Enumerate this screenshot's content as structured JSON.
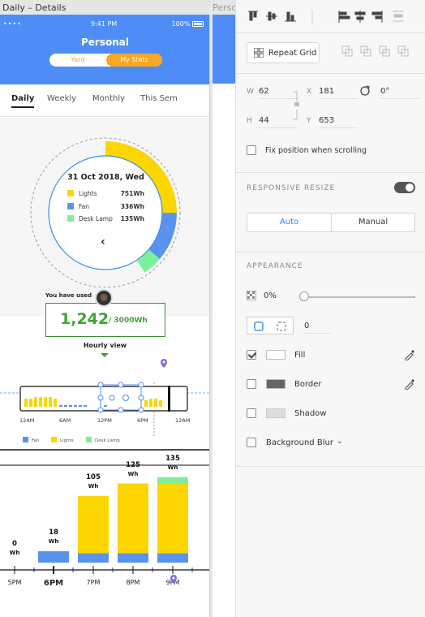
{
  "canvas": {
    "artboard_title": "Daily – Details",
    "artboard2_title": "Perso"
  },
  "phone": {
    "status": {
      "signal": "••••",
      "time": "9:41 PM",
      "battery": "100%"
    },
    "title": "Personal",
    "segment": {
      "left": "Yard",
      "right": "My Stats",
      "selected": "My Stats"
    },
    "tabs": [
      {
        "label": "Daily",
        "active": true
      },
      {
        "label": "Weekly",
        "active": false
      },
      {
        "label": "Monthly",
        "active": false
      },
      {
        "label": "This Sem",
        "active": false
      }
    ],
    "donut": {
      "date": "31 Oct 2018, Wed",
      "legend": [
        {
          "name": "Lights",
          "value": "751Wh",
          "color": "#fdd600"
        },
        {
          "name": "Fan",
          "value": "336Wh",
          "color": "#5a93ee"
        },
        {
          "name": "Desk Lamp",
          "value": "135Wh",
          "color": "#7cf09a"
        }
      ],
      "segments": [
        {
          "name": "Lights",
          "value": 751
        },
        {
          "name": "Fan",
          "value": 336
        },
        {
          "name": "Desk Lamp",
          "value": 135
        }
      ],
      "total": 3000,
      "prev_icon": "‹"
    },
    "usage": {
      "caption": "You have used",
      "value": "1,242",
      "total": "/ 3000Wh"
    },
    "hourly": {
      "label": "Hourly view",
      "ticks": [
        "12AM",
        "6AM",
        "12PM",
        "6PM",
        "12AM"
      ],
      "legend": [
        {
          "name": "Fan",
          "color": "#5a93ee"
        },
        {
          "name": "Lights",
          "color": "#fdd600"
        },
        {
          "name": "Desk Lamp",
          "color": "#7cf09a"
        }
      ]
    }
  },
  "chart_data": {
    "type": "bar",
    "categories": [
      "5PM",
      "6PM",
      "7PM",
      "8PM",
      "9PM"
    ],
    "series": [
      {
        "name": "Fan",
        "values": [
          0,
          18,
          15,
          15,
          15
        ]
      },
      {
        "name": "Lights",
        "values": [
          0,
          0,
          90,
          110,
          110
        ]
      },
      {
        "name": "Desk Lamp",
        "values": [
          0,
          0,
          0,
          0,
          10
        ]
      }
    ],
    "totals": [
      "0",
      "18",
      "105",
      "125",
      "135"
    ],
    "unit": "Wh",
    "selected": "6PM",
    "ylim": [
      0,
      140
    ]
  },
  "inspector": {
    "repeat_grid": "Repeat Grid",
    "w_label": "W",
    "w_value": "62",
    "h_label": "H",
    "h_value": "44",
    "x_label": "X",
    "x_value": "181",
    "y_label": "Y",
    "y_value": "653",
    "rotation": "0°",
    "fix_position": "Fix position when scrolling",
    "responsive_title": "RESPONSIVE RESIZE",
    "auto": "Auto",
    "manual": "Manual",
    "appearance_title": "APPEARANCE",
    "opacity": "0%",
    "radius": "0",
    "fill": "Fill",
    "border": "Border",
    "shadow": "Shadow",
    "blur": "Background Blur"
  }
}
